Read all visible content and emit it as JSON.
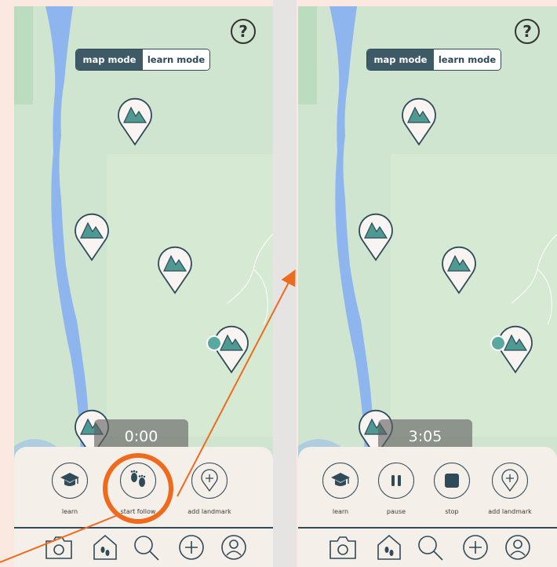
{
  "screens": [
    {
      "help_label": "?",
      "mode_toggle": {
        "active": "map mode",
        "inactive": "learn mode"
      },
      "timer": "0:00",
      "actions": [
        {
          "label": "learn",
          "icon": "graduation-cap-icon"
        },
        {
          "label": "start follow",
          "icon": "footprints-icon"
        },
        {
          "label": "add landmark",
          "icon": "add-pin-icon"
        }
      ],
      "nav": [
        "camera-icon",
        "home-footprint-icon",
        "search-icon",
        "plus-icon",
        "profile-icon"
      ]
    },
    {
      "help_label": "?",
      "mode_toggle": {
        "active": "map mode",
        "inactive": "learn mode"
      },
      "timer": "3:05",
      "actions": [
        {
          "label": "learn",
          "icon": "graduation-cap-icon"
        },
        {
          "label": "pause",
          "icon": "pause-icon"
        },
        {
          "label": "stop",
          "icon": "stop-icon"
        },
        {
          "label": "add landmark",
          "icon": "add-pin-icon"
        }
      ],
      "nav": [
        "camera-icon",
        "home-footprint-icon",
        "search-icon",
        "plus-icon",
        "profile-icon"
      ]
    }
  ],
  "colors": {
    "map_background": "#cfe5cf",
    "river": "#8fb5ee",
    "pin_fill": "#f7f4f1",
    "pin_stroke": "#2f4a58",
    "mountain": "#4e9a93",
    "accent_circle": "#f06a1e",
    "annotation_line": "#f06a1e"
  }
}
